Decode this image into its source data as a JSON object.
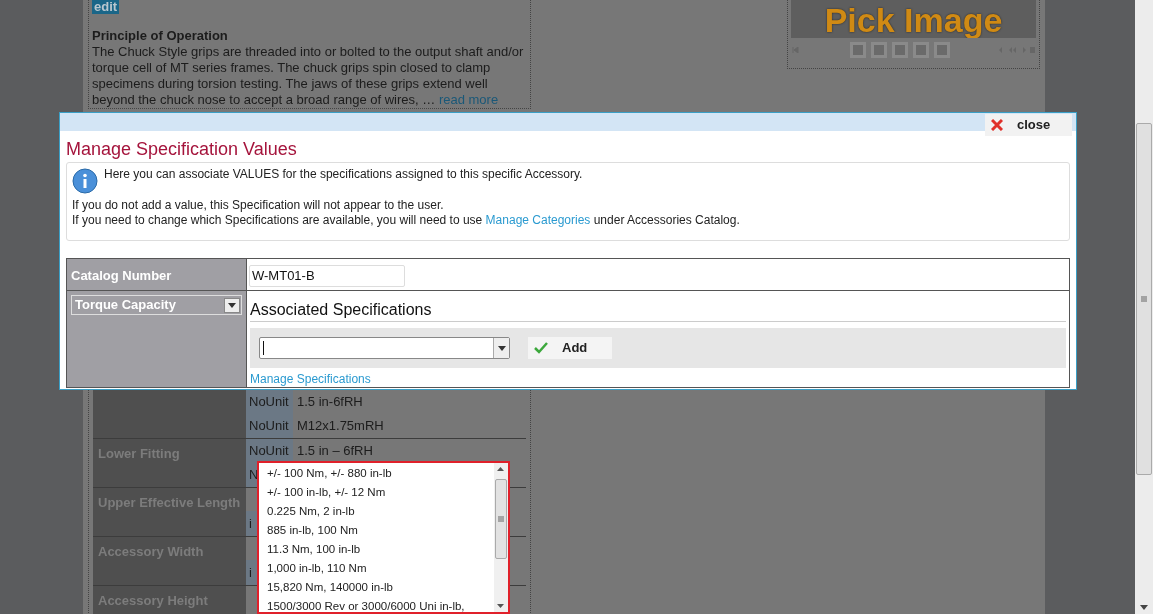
{
  "background_page": {
    "edit_badge": "edit",
    "section_heading": "Principle of Operation",
    "paragraph": "The Chuck Style grips are threaded into or bolted to the output shaft and/or torque cell of MT series frames. The chuck grips spin closed to clamp specimens during torsion testing. The jaws of these grips extend well beyond the chuck nose to accept a broad range of wires, …",
    "read_more_link": "read more",
    "pick_image_label": "Pick Image",
    "spec_rows": [
      {
        "values": [
          {
            "unit": "NoUnit",
            "value": "1.5 in-6fRH"
          },
          {
            "unit": "NoUnit",
            "value": "M12x1.75mRH"
          }
        ]
      },
      {
        "label": "Lower Fitting",
        "values": [
          {
            "unit": "NoUnit",
            "value": "1.5 in – 6fRH"
          },
          {
            "unit": "N"
          }
        ]
      },
      {
        "label": "Upper Effective Length",
        "values": [
          {
            "unit": "i"
          }
        ]
      },
      {
        "label": "Accessory Width",
        "values": [
          {
            "unit": "i"
          }
        ]
      },
      {
        "label": "Accessory Height"
      }
    ]
  },
  "dialog": {
    "close_button": "close",
    "title": "Manage Specification Values",
    "info": {
      "line_1": "Here you can associate VALUES for the specifications assigned to this specific Accessory.",
      "line_2": "If you do not add a value, this Specification will not appear to the user.",
      "line_3_before": "If you need to change which Specifications are available, you will need to use",
      "line_3_link": "Manage Categories",
      "line_3_after": "under Accessories Catalog."
    },
    "catalog_number": {
      "label": "Catalog Number",
      "value": "W-MT01-B"
    },
    "specification_select": {
      "value": "Torque Capacity"
    },
    "section_heading": "Associated Specifications",
    "add_button": "Add",
    "manage_link": "Manage Specifications"
  },
  "dropdown_options": [
    {
      "label": "+/- 100 Nm, +/- 880 in-lb",
      "selected": false
    },
    {
      "label": "+/- 100 in-lb, +/- 12 Nm",
      "selected": false
    },
    {
      "label": "0.225 Nm, 2 in-lb",
      "selected": false
    },
    {
      "label": "885 in-lb, 100 Nm",
      "selected": false
    },
    {
      "label": "11.3 Nm, 100 in-lb",
      "selected": false
    },
    {
      "label": "1,000 in-lb, 110 Nm",
      "selected": false
    },
    {
      "label": "15,820 Nm, 140000 in-lb",
      "selected": false
    },
    {
      "label": "1500/3000 Rev or 3000/6000 Uni in-lb,",
      "selected": false
    }
  ]
}
